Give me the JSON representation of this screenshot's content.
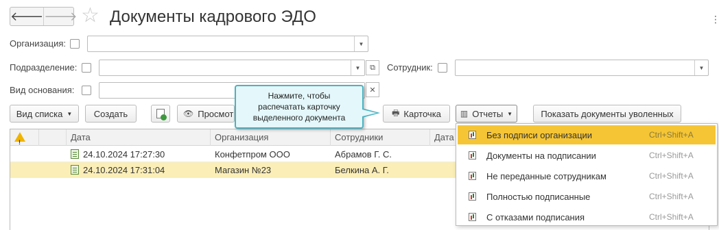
{
  "title": "Документы кадрового ЭДО",
  "nav": {
    "back": "🡐",
    "forward": "🡒",
    "more": "⋮"
  },
  "filters": {
    "organization": {
      "label": "Организация:",
      "value": ""
    },
    "department": {
      "label": "Подразделение:",
      "value": ""
    },
    "employee": {
      "label": "Сотрудник:",
      "value": ""
    },
    "basis_type": {
      "label": "Вид основания:",
      "value": ""
    }
  },
  "toolbar": {
    "view_list": "Вид списка",
    "create": "Создать",
    "preview": "Просмотр",
    "card": "Карточка",
    "reports": "Отчеты",
    "show_dismissed": "Показать документы уволенных"
  },
  "tooltip": {
    "text": "Нажмите, чтобы\nраспечатать карточку\nвыделенного документа"
  },
  "table": {
    "columns": [
      "Дата",
      "Организация",
      "Сотрудники",
      "Дата"
    ],
    "rows": [
      {
        "date": "24.10.2024 17:27:30",
        "organization": "Конфетпром ООО",
        "employees": "Абрамов Г. С."
      },
      {
        "date": "24.10.2024 17:31:04",
        "organization": "Магазин №23",
        "employees": "Белкина А. Г."
      }
    ]
  },
  "reports_menu": {
    "items": [
      {
        "label": "Без подписи организации",
        "shortcut": "Ctrl+Shift+A"
      },
      {
        "label": "Документы на подписании",
        "shortcut": "Ctrl+Shift+A"
      },
      {
        "label": "Не переданные сотрудникам",
        "shortcut": "Ctrl+Shift+A"
      },
      {
        "label": "Полностью подписанные",
        "shortcut": "Ctrl+Shift+A"
      },
      {
        "label": "С отказами подписания",
        "shortcut": "Ctrl+Shift+A"
      }
    ],
    "highlighted_index": 0
  },
  "colors": {
    "selected_row": "#fbeeb7",
    "menu_highlight": "#f5c535",
    "tooltip_border": "#4bb3c2",
    "tooltip_bg": "#e4f7fa"
  },
  "icons": {
    "warning": "warning-icon",
    "star": "star-icon",
    "document": "document-icon",
    "report": "report-icon"
  }
}
